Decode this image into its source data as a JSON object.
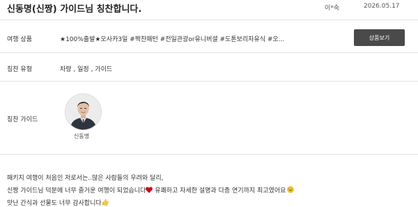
{
  "header": {
    "title": "신동명(신짱) 가이드님 칭찬합니다.",
    "author": "이*숙",
    "date": "2026.05.17"
  },
  "rows": {
    "product": {
      "label": "여행 상품",
      "value": "★100%출발★오사카3일 #짝찬패턴 #전일관광or유니버셜 #도톤보리자유식 #오...",
      "button": "상품보기"
    },
    "praise_type": {
      "label": "칭찬 유형",
      "value": "차량 , 일정 , 가이드"
    },
    "praise_guide": {
      "label": "칭찬 가이드",
      "guide_name": "신동명"
    }
  },
  "review": {
    "line1": "패키지 여행이 처음인 저로서는..많은 사람들의 우려와 달리,",
    "line2a": "신짱 가이드님 덕분에 너무 즐거운 여행이 되었습니다",
    "line2b": " 유쾌하고 자세한 설명과 다층 연기까지 최고였어요",
    "line3": "맛난 간식과 선물도 너무 감사합니다"
  },
  "colors": {
    "button_bg": "#4a4a4a",
    "heart": "#d0021b"
  }
}
